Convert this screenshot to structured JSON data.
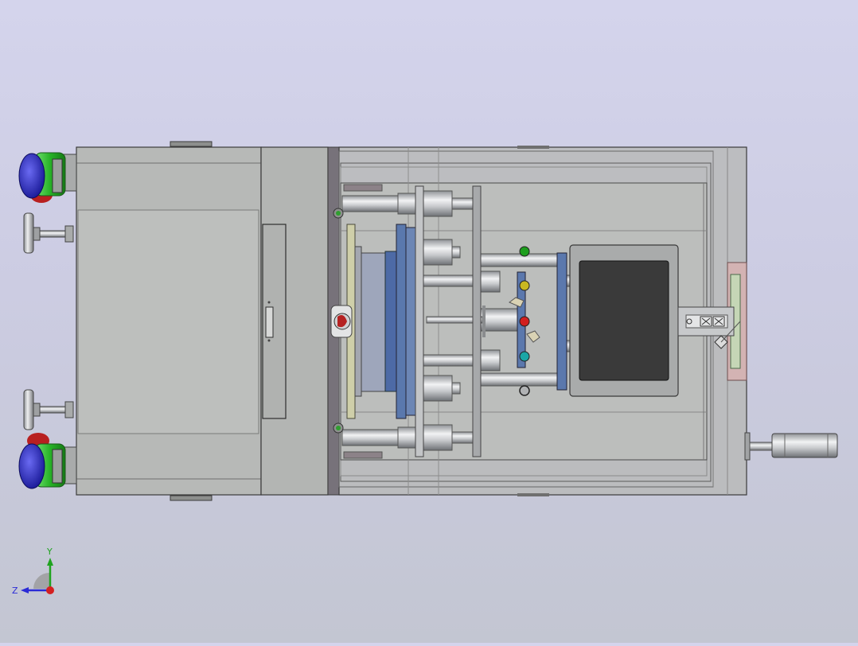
{
  "viewport": {
    "background_top": "#d4d4ec",
    "background_bottom": "#c3c6d2"
  },
  "triad": {
    "y_label": "Y",
    "z_label": "Z",
    "y_color": "#1fa31f",
    "z_color": "#2b2bd6",
    "x_color": "#d42020"
  },
  "parts": {
    "housing_color": "#b9bbb9",
    "frame_color": "#a9aaa9",
    "plate_blue": "#5b76a6",
    "motor_green": "#27b227",
    "motor_blue": "#1f1fbf",
    "motor_red": "#b82020",
    "window_color": "#3a3a3a",
    "indicator_colors": [
      "#1e9e1e",
      "#c9b820",
      "#d12020",
      "#1aa6a6",
      "#2e2e2e"
    ]
  }
}
